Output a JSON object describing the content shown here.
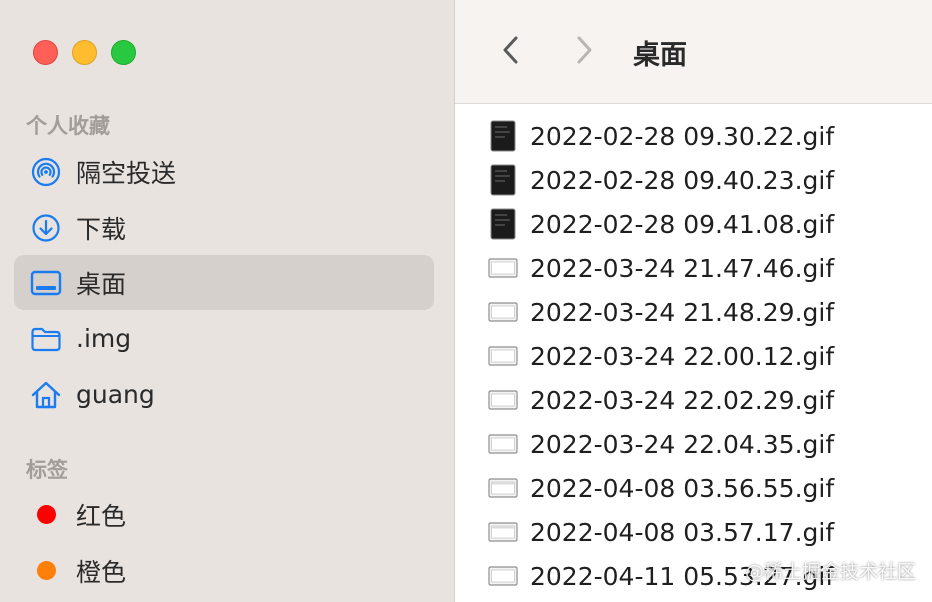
{
  "window": {
    "title": "桌面"
  },
  "sidebar": {
    "favorites_title": "个人收藏",
    "favorites": [
      {
        "label": "隔空投送",
        "icon": "airdrop-icon"
      },
      {
        "label": "下载",
        "icon": "download-icon"
      },
      {
        "label": "桌面",
        "icon": "desktop-icon",
        "selected": true
      },
      {
        "label": ".img",
        "icon": "folder-icon"
      },
      {
        "label": "guang",
        "icon": "home-icon"
      }
    ],
    "tags_title": "标签",
    "tags": [
      {
        "label": "红色",
        "color": "#fe0000"
      },
      {
        "label": "橙色",
        "color": "#fe7f0a"
      }
    ]
  },
  "files": [
    {
      "name": "2022-02-28 09.30.22.gif",
      "thumb": "dark"
    },
    {
      "name": "2022-02-28 09.40.23.gif",
      "thumb": "dark"
    },
    {
      "name": "2022-02-28 09.41.08.gif",
      "thumb": "dark"
    },
    {
      "name": "2022-03-24 21.47.46.gif",
      "thumb": "light"
    },
    {
      "name": "2022-03-24 21.48.29.gif",
      "thumb": "light"
    },
    {
      "name": "2022-03-24 22.00.12.gif",
      "thumb": "light"
    },
    {
      "name": "2022-03-24 22.02.29.gif",
      "thumb": "light"
    },
    {
      "name": "2022-03-24 22.04.35.gif",
      "thumb": "light"
    },
    {
      "name": "2022-04-08 03.56.55.gif",
      "thumb": "light"
    },
    {
      "name": "2022-04-08 03.57.17.gif",
      "thumb": "light"
    },
    {
      "name": "2022-04-11 05.53.27.gif",
      "thumb": "light"
    }
  ],
  "watermark": "@稀土掘金技术社区",
  "colors": {
    "accent": "#1a7cf0",
    "sidebar_bg": "#e8e3df",
    "selected_bg": "#d5d0cc"
  }
}
